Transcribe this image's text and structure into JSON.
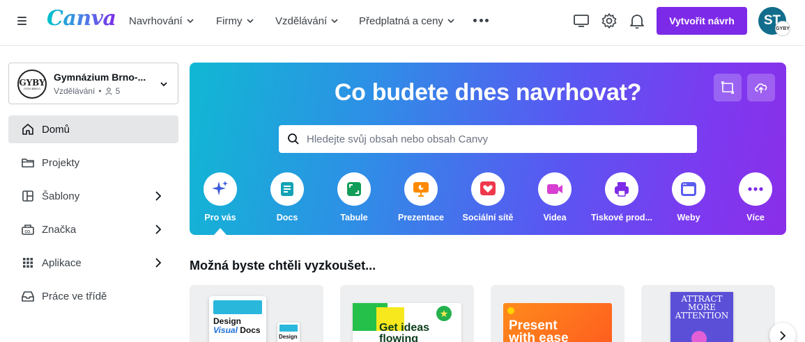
{
  "header": {
    "logo": "Canva",
    "nav": [
      {
        "label": "Navrhování",
        "icon": "chevron-down-icon"
      },
      {
        "label": "Firmy",
        "icon": "chevron-down-icon"
      },
      {
        "label": "Vzdělávání",
        "icon": "chevron-down-icon"
      },
      {
        "label": "Předplatná a ceny",
        "icon": "chevron-down-icon"
      }
    ],
    "more_icon": "more-horizontal-icon",
    "icons": [
      "monitor-icon",
      "gear-icon",
      "bell-icon"
    ],
    "create_label": "Vytvořit návrh",
    "avatar_initials": "ST",
    "avatar_badge": "GYBY",
    "accent": "#7d2ae8"
  },
  "sidebar": {
    "team": {
      "name": "Gymnázium Brno-...",
      "type": "Vzdělávání",
      "members": "5",
      "logo_text": "GYBY",
      "logo_subtext": "GYM BRNO"
    },
    "items": [
      {
        "label": "Domů",
        "icon": "home-icon",
        "active": true
      },
      {
        "label": "Projekty",
        "icon": "folder-icon"
      },
      {
        "label": "Šablony",
        "icon": "template-icon",
        "has_arrow": true
      },
      {
        "label": "Značka",
        "icon": "brand-icon",
        "has_arrow": true
      },
      {
        "label": "Aplikace",
        "icon": "apps-grid-icon",
        "has_arrow": true
      },
      {
        "label": "Práce ve třídě",
        "icon": "inbox-icon"
      }
    ]
  },
  "hero": {
    "title": "Co budete dnes navrhovat?",
    "search_placeholder": "Hledejte svůj obsah nebo obsah Canvy",
    "buttons": [
      "resize-icon",
      "upload-cloud-icon"
    ],
    "categories": [
      {
        "label": "Pro vás",
        "icon": "sparkle-icon",
        "color": "#3b5bdb",
        "active": true
      },
      {
        "label": "Docs",
        "icon": "docs-icon",
        "color": "#13a3b5"
      },
      {
        "label": "Tabule",
        "icon": "whiteboard-icon",
        "color": "#0f9d58"
      },
      {
        "label": "Prezentace",
        "icon": "presentation-icon",
        "color": "#ff8a00"
      },
      {
        "label": "Sociální sítě",
        "icon": "heart-icon",
        "color": "#f0384c"
      },
      {
        "label": "Videa",
        "icon": "video-icon",
        "color": "#d63fd1"
      },
      {
        "label": "Tiskové prod...",
        "icon": "printer-icon",
        "color": "#7d2ae8"
      },
      {
        "label": "Weby",
        "icon": "website-icon",
        "color": "#5a5cf0"
      },
      {
        "label": "Více",
        "icon": "more-horizontal-icon",
        "color": "#7d2ae8"
      }
    ]
  },
  "suggestions": {
    "title": "Možná byste chtěli vyzkoušet...",
    "cards": [
      {
        "name": "card-design-visual-docs",
        "line1": "Design",
        "line2": "Visual",
        "line3": "Docs",
        "mini": "Design"
      },
      {
        "name": "card-whiteboard",
        "line1": "Get ideas",
        "line2": "flowing"
      },
      {
        "name": "card-presentation",
        "line1": "Present",
        "line2": "with ease"
      },
      {
        "name": "card-print",
        "line1": "ATTRACT",
        "line2": "MORE",
        "line3": "ATTENTION"
      }
    ],
    "next_icon": "chevron-right-icon"
  }
}
